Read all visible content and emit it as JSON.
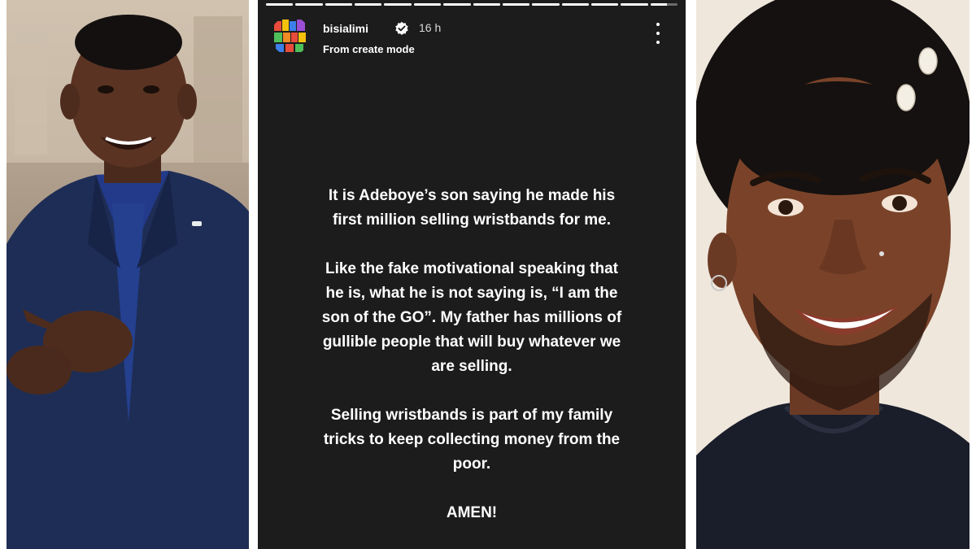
{
  "story": {
    "progress_segments": [
      1,
      1,
      1,
      1,
      1,
      1,
      1,
      1,
      1,
      1,
      1,
      1,
      1,
      0.6
    ],
    "header": {
      "username": "bisialimi",
      "time": "16 h",
      "subtitle": "From create mode",
      "verified_icon": "verified-badge-icon",
      "menu_icon": "more-vertical-icon"
    },
    "paragraphs": [
      "It is Adeboye’s son saying he made his\nfirst million selling wristbands for me.",
      "Like the fake motivational speaking that\nhe is, what he is not saying is, “I am the\nson of the GO”.  My father has millions of\ngullible people that will buy whatever we\nare selling.",
      "Selling wristbands is part of my family\ntricks to keep collecting money from the\npoor.",
      "AMEN!"
    ],
    "colors": {
      "background": "#1c1c1c",
      "text": "#ffffff"
    }
  },
  "left_photo": {
    "subject": "man-in-navy-suit-speaking"
  },
  "right_photo": {
    "subject": "smiling-man-with-cowrie-shells-in-hair"
  }
}
